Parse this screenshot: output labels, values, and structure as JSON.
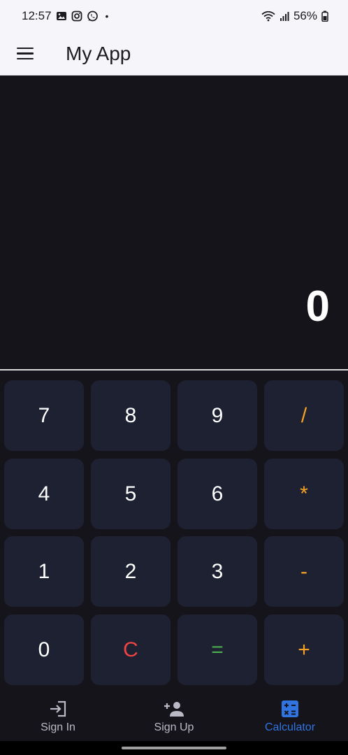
{
  "status_bar": {
    "time": "12:57",
    "battery": "56%",
    "dot": "•"
  },
  "app_bar": {
    "title": "My App",
    "menu_icon": "hamburger-menu-icon"
  },
  "display": {
    "value": "0"
  },
  "keypad": {
    "keys": [
      "7",
      "8",
      "9",
      "/",
      "4",
      "5",
      "6",
      "*",
      "1",
      "2",
      "3",
      "-",
      "0",
      "C",
      "=",
      "+"
    ]
  },
  "bottom_nav": {
    "items": [
      {
        "label": "Sign In",
        "icon": "login-icon"
      },
      {
        "label": "Sign Up",
        "icon": "person-add-icon"
      },
      {
        "label": "Calculator",
        "icon": "calculator-icon",
        "active": true
      }
    ]
  },
  "colors": {
    "background": "#16141b",
    "key_background": "#1e2132",
    "operator": "#f5a123",
    "clear": "#ef4444",
    "equals": "#4caf50",
    "nav_active": "#2f74e0"
  }
}
